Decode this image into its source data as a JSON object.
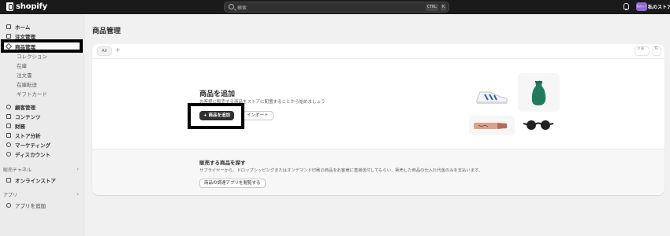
{
  "topbar": {
    "logo_text": "shopify",
    "search_placeholder": "検索",
    "shortcut_ctrl": "CTRL",
    "shortcut_key": "K",
    "store_name": "私のストア",
    "avatar_text": "私のスト"
  },
  "sidebar": {
    "items": [
      {
        "label": "ホーム",
        "icon": "home-icon"
      },
      {
        "label": "注文管理",
        "icon": "orders-icon"
      },
      {
        "label": "商品管理",
        "icon": "tag-icon"
      }
    ],
    "sub_items": [
      "コレクション",
      "在庫",
      "注文書",
      "在庫転送",
      "ギフトカード"
    ],
    "more_items": [
      {
        "label": "顧客管理",
        "icon": "customers-icon"
      },
      {
        "label": "コンテンツ",
        "icon": "content-icon"
      },
      {
        "label": "財務",
        "icon": "finance-icon"
      },
      {
        "label": "ストア分析",
        "icon": "analytics-icon"
      },
      {
        "label": "マーケティング",
        "icon": "marketing-icon"
      },
      {
        "label": "ディスカウント",
        "icon": "discount-icon"
      }
    ],
    "sales_channels_label": "販売チャネル",
    "online_store_label": "オンラインストア",
    "apps_label": "アプリ",
    "add_apps_label": "アプリを追加"
  },
  "main": {
    "page_title": "商品管理",
    "tab_all": "All",
    "tab_add": "+",
    "empty_state": {
      "title": "商品を追加",
      "description": "お客様に販売する商品をストアに配置することから始めましょう",
      "add_button": "+ 商品を追加",
      "import_button": "インポート"
    },
    "discover": {
      "title": "販売する商品を探す",
      "description": "サプライヤーから、ドロップシッピングまたはオンデマンド印刷の商品をお客様に直接送付してもらい、販売した商品の仕入れ代金のみを支払います。",
      "button": "商品の調達アプリを閲覧する"
    }
  },
  "colors": {
    "topbar": "#1a1a1a",
    "sidebar": "#ebebeb",
    "background": "#f1f1f1",
    "primary_button": "#303030",
    "highlight_border": "#000000",
    "avatar": "#8e6bd6"
  }
}
